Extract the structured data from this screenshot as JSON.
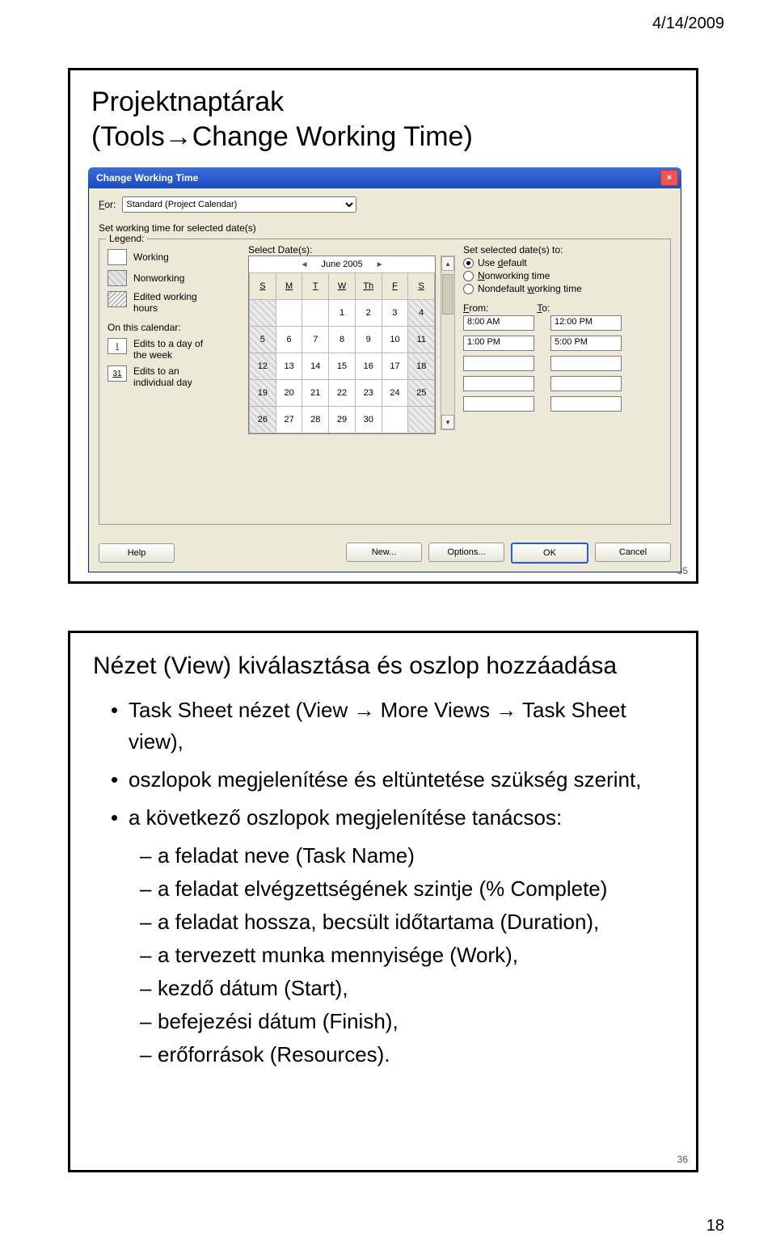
{
  "page": {
    "date": "4/14/2009",
    "number": "18"
  },
  "slide1": {
    "num": "35",
    "title_l1": "Projektnaptárak",
    "title_l2": "(Tools→Change Working Time)",
    "dialog": {
      "title": "Change Working Time",
      "for_label_pre": "F",
      "for_label_post": "or:",
      "for_value": "Standard (Project Calendar)",
      "setline": "Set working time for selected date(s)",
      "legend_label": "Legend:",
      "legend_working": "Working",
      "legend_nonworking": "Nonworking",
      "legend_editedhours_l1": "Edited working",
      "legend_editedhours_l2": "hours",
      "on_calendar": "On this calendar:",
      "edits_day_week_l1": "Edits to a day of",
      "edits_day_week_l2": "the week",
      "edits_day_week_box": "I",
      "edits_individual_l1": "Edits to an",
      "edits_individual_l2": "individual day",
      "edits_individual_box": "31",
      "select_dates": "Select Date(s):",
      "cal_month": "June 2005",
      "dow": [
        "S",
        "M",
        "T",
        "W",
        "Th",
        "F",
        "S"
      ],
      "weeks": [
        [
          "",
          "",
          "",
          "1",
          "2",
          "3",
          "4"
        ],
        [
          "5",
          "6",
          "7",
          "8",
          "9",
          "10",
          "11"
        ],
        [
          "12",
          "13",
          "14",
          "15",
          "16",
          "17",
          "18"
        ],
        [
          "19",
          "20",
          "21",
          "22",
          "23",
          "24",
          "25"
        ],
        [
          "26",
          "27",
          "28",
          "29",
          "30",
          "",
          ""
        ]
      ],
      "set_to": "Set selected date(s) to:",
      "opt_default_pre": "Use ",
      "opt_default_und": "d",
      "opt_default_post": "efault",
      "opt_nonworking_und": "N",
      "opt_nonworking_post": "onworking time",
      "opt_nondefault_pre": "Nondefault ",
      "opt_nondefault_und": "w",
      "opt_nondefault_post": "orking time",
      "from_und": "F",
      "from_post": "rom:",
      "to_und": "T",
      "to_post": "o:",
      "from1": "8:00 AM",
      "to1": "12:00 PM",
      "from2": "1:00 PM",
      "to2": "5:00 PM",
      "btn_help": "Help",
      "btn_new": "New...",
      "btn_options": "Options...",
      "btn_ok": "OK",
      "btn_cancel": "Cancel"
    }
  },
  "slide2": {
    "num": "36",
    "title": "Nézet (View) kiválasztása és oszlop hozzáadása",
    "b1a": "Task Sheet nézet (View → More Views → Task Sheet view),",
    "b1b": "oszlopok megjelenítése és eltüntetése szükség szerint,",
    "b1c": "a következő oszlopok megjelenítése tanácsos:",
    "b2a": "a feladat neve (Task Name)",
    "b2b": "a feladat elvégzettségének szintje (% Complete)",
    "b2c": "a feladat hossza, becsült időtartama (Duration),",
    "b2d": "a tervezett munka mennyisége (Work),",
    "b2e": "kezdő dátum (Start),",
    "b2f": "befejezési dátum (Finish),",
    "b2g": "erőforrások (Resources)."
  }
}
